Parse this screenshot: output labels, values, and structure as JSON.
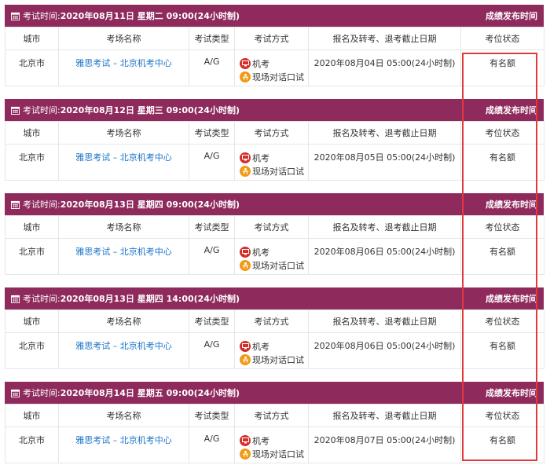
{
  "headers": {
    "city": "城市",
    "venue": "考场名称",
    "type": "考试类型",
    "mode": "考试方式",
    "deadline": "报名及转考、退考截止日期",
    "status": "考位状态"
  },
  "sessions": [
    {
      "time_label": "考试时间:",
      "time_value": "2020年08月11日 星期二 09:00(24小时制)",
      "right_label": "成绩发布时间",
      "city": "北京市",
      "venue": "雅思考试 – 北京机考中心",
      "type": "A/G",
      "mode1": "机考",
      "mode2": "现场对话口试",
      "deadline": "2020年08月04日 05:00(24小时制)",
      "status": "有名额"
    },
    {
      "time_label": "考试时间:",
      "time_value": "2020年08月12日 星期三 09:00(24小时制)",
      "right_label": "成绩发布时间",
      "city": "北京市",
      "venue": "雅思考试 – 北京机考中心",
      "type": "A/G",
      "mode1": "机考",
      "mode2": "现场对话口试",
      "deadline": "2020年08月05日 05:00(24小时制)",
      "status": "有名额"
    },
    {
      "time_label": "考试时间:",
      "time_value": "2020年08月13日 星期四 09:00(24小时制)",
      "right_label": "成绩发布时间",
      "city": "北京市",
      "venue": "雅思考试 – 北京机考中心",
      "type": "A/G",
      "mode1": "机考",
      "mode2": "现场对话口试",
      "deadline": "2020年08月06日 05:00(24小时制)",
      "status": "有名额"
    },
    {
      "time_label": "考试时间:",
      "time_value": "2020年08月13日 星期四 14:00(24小时制)",
      "right_label": "成绩发布时间",
      "city": "北京市",
      "venue": "雅思考试 – 北京机考中心",
      "type": "A/G",
      "mode1": "机考",
      "mode2": "现场对话口试",
      "deadline": "2020年08月06日 05:00(24小时制)",
      "status": "有名额"
    },
    {
      "time_label": "考试时间:",
      "time_value": "2020年08月14日 星期五 09:00(24小时制)",
      "right_label": "成绩发布时间",
      "city": "北京市",
      "venue": "雅思考试 – 北京机考中心",
      "type": "A/G",
      "mode1": "机考",
      "mode2": "现场对话口试",
      "deadline": "2020年08月07日 05:00(24小时制)",
      "status": "有名额"
    }
  ]
}
